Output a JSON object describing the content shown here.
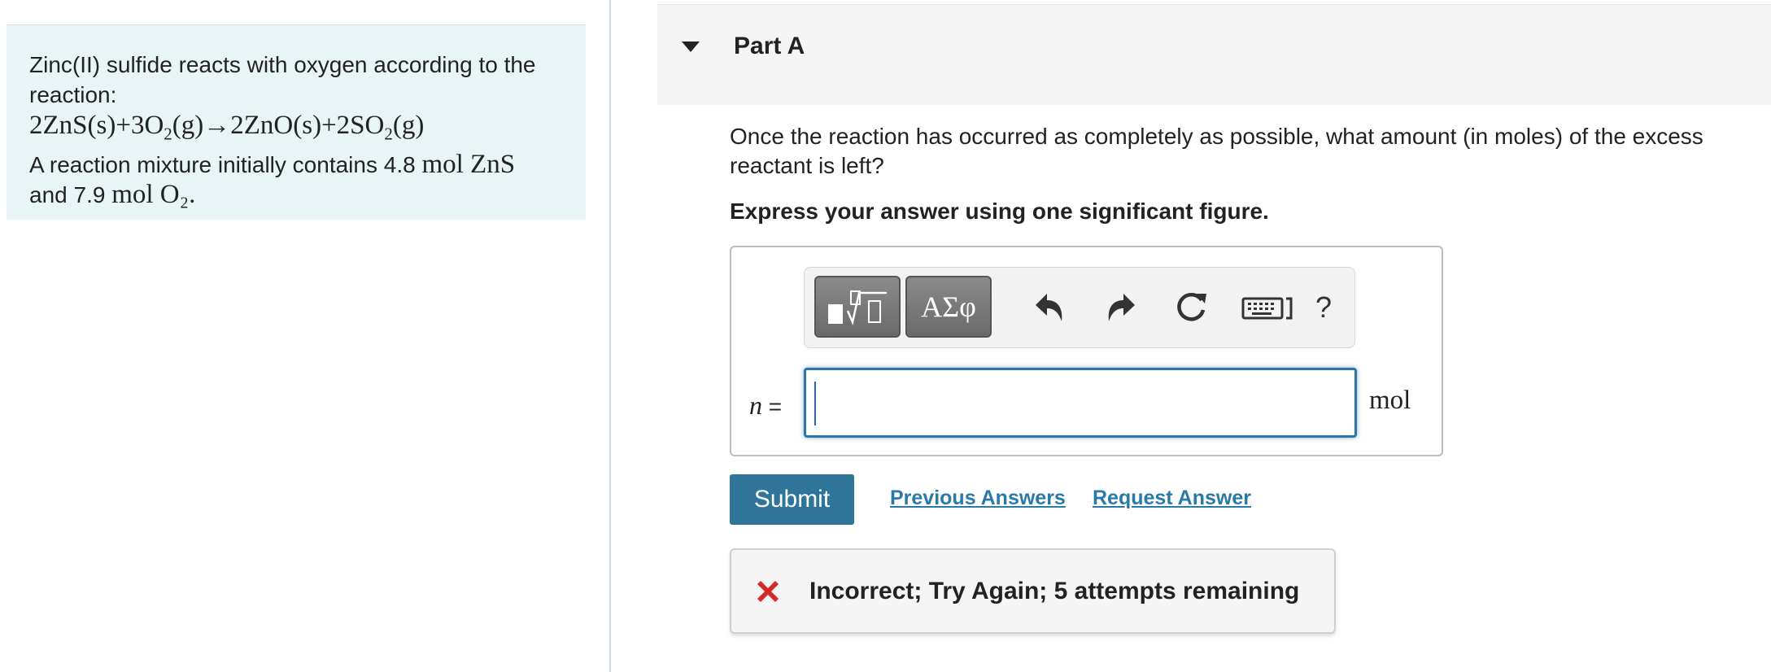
{
  "intro": {
    "line1": "Zinc(II) sulfide reacts with oxygen according to the reaction:",
    "equation": {
      "p1": "2ZnS(s)+3O",
      "p1_sub": "2",
      "p2": "(g)→2ZnO(s)+2SO",
      "p2_sub": "2",
      "p3": "(g)"
    },
    "line2_prefix": "A reaction mixture initially contains 4.8 ",
    "line2_unit": "mol ZnS",
    "line3_prefix": "and 7.9 ",
    "line3_unit": "mol O₂."
  },
  "part": {
    "title": "Part A"
  },
  "question": {
    "text": "Once the reaction has occurred as completely as possible, what amount (in moles) of the excess reactant is left?",
    "instruction": "Express your answer using one significant figure."
  },
  "toolbar": {
    "greek_label": "ΑΣφ",
    "help_label": "?"
  },
  "answer": {
    "variable": "n",
    "equals": "=",
    "value": "",
    "unit": "mol"
  },
  "actions": {
    "submit": "Submit",
    "previous_answers": "Previous Answers",
    "request_answer": "Request Answer"
  },
  "feedback": {
    "text": "Incorrect; Try Again; 5 attempts remaining"
  },
  "colors": {
    "accent": "#2e7599",
    "link": "#2a7aa8",
    "error": "#d62828",
    "intro_bg": "#e9f4f7"
  }
}
